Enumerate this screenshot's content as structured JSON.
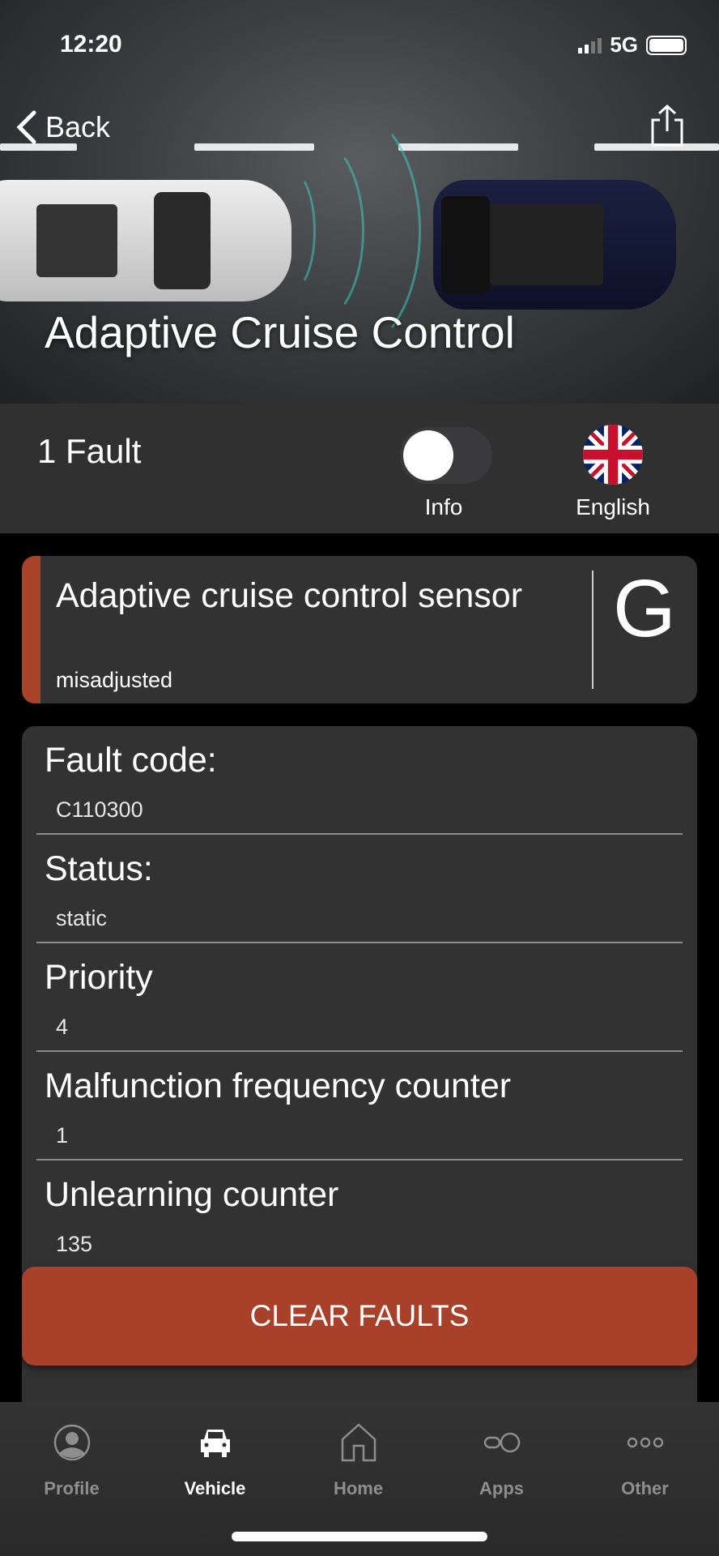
{
  "status_bar": {
    "time": "12:20",
    "network": "5G"
  },
  "header": {
    "back_label": "Back",
    "title": "Adaptive Cruise Control"
  },
  "fault_bar": {
    "count_label": "1 Fault",
    "info_toggle_label": "Info",
    "info_toggle_on": false,
    "language_label": "English"
  },
  "fault_card": {
    "title": "Adaptive cruise control sensor",
    "subtitle": "misadjusted",
    "translate_icon": "google-g-icon",
    "accent_color": "#a8432a"
  },
  "details": [
    {
      "label": "Fault code:",
      "value": "C110300"
    },
    {
      "label": "Status:",
      "value": "static"
    },
    {
      "label": "Priority",
      "value": "4"
    },
    {
      "label": "Malfunction frequency counter",
      "value": "1"
    },
    {
      "label": "Unlearning counter",
      "value": "135"
    }
  ],
  "clear_button": {
    "label": "CLEAR FAULTS",
    "color": "#a8402a"
  },
  "tabs": [
    {
      "label": "Profile",
      "icon": "profile-icon"
    },
    {
      "label": "Vehicle",
      "icon": "car-icon",
      "active": true
    },
    {
      "label": "Home",
      "icon": "home-icon"
    },
    {
      "label": "Apps",
      "icon": "apps-icon"
    },
    {
      "label": "Other",
      "icon": "more-icon"
    }
  ]
}
